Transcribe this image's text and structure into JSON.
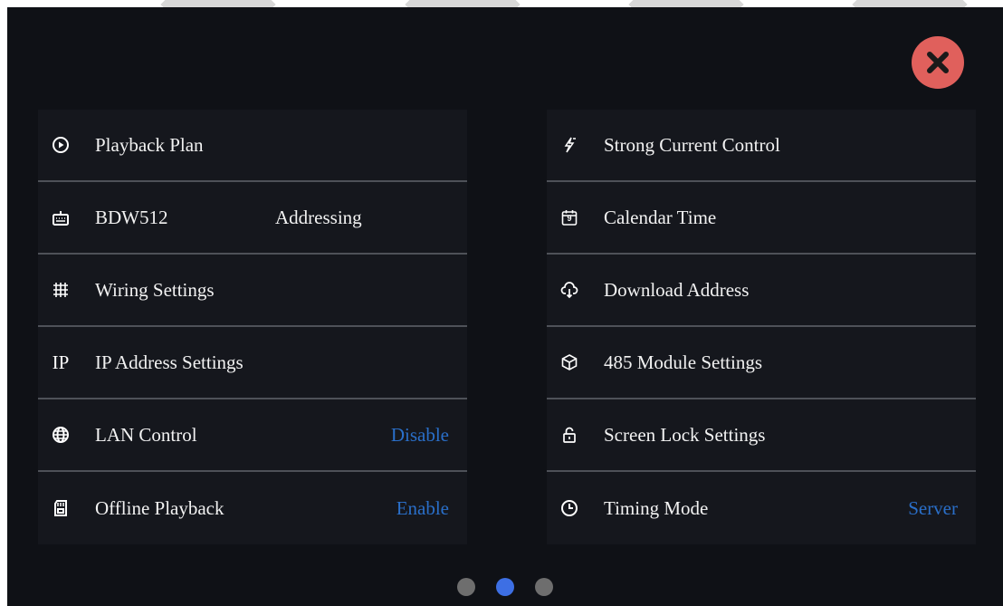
{
  "colors": {
    "background": "#0f1116",
    "row_background": "#15171d",
    "divider": "#4e5158",
    "value_blue": "#2a6fc9",
    "close_red": "#e0605c",
    "dot_active": "#3d6fe4",
    "dot_inactive": "#6e6e6e"
  },
  "left_items": [
    {
      "icon": "play-circle-icon",
      "label": "Playback Plan"
    },
    {
      "icon": "keyboard-icon",
      "label": "BDW512",
      "extra": "Addressing"
    },
    {
      "icon": "grid-icon",
      "label": "Wiring Settings"
    },
    {
      "icon": "ip-text-icon",
      "icon_text": "IP",
      "label": "IP Address Settings"
    },
    {
      "icon": "globe-icon",
      "label": "LAN Control",
      "value": "Disable"
    },
    {
      "icon": "sd-card-icon",
      "label": "Offline Playback",
      "value": "Enable"
    }
  ],
  "right_items": [
    {
      "icon": "lightning-icon",
      "label": "Strong Current Control"
    },
    {
      "icon": "calendar-icon",
      "icon_text": "9",
      "label": "Calendar Time"
    },
    {
      "icon": "cloud-download-icon",
      "label": "Download Address"
    },
    {
      "icon": "cube-icon",
      "label": "485 Module Settings"
    },
    {
      "icon": "lock-icon",
      "label": "Screen Lock Settings"
    },
    {
      "icon": "clock-icon",
      "label": "Timing Mode",
      "value": "Server"
    }
  ],
  "pagination": {
    "pages": 3,
    "active_page": 2
  }
}
